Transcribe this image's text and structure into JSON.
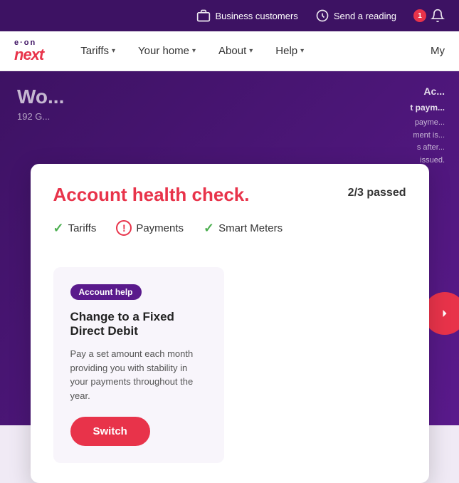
{
  "topbar": {
    "business_customers_label": "Business customers",
    "send_reading_label": "Send a reading",
    "notification_count": "1"
  },
  "navbar": {
    "logo_eon": "e·on",
    "logo_next": "next",
    "tariffs_label": "Tariffs",
    "your_home_label": "Your home",
    "about_label": "About",
    "help_label": "Help",
    "my_label": "My"
  },
  "bg": {
    "welcome_text": "Wo...",
    "address": "192 G..."
  },
  "modal": {
    "title": "Account health check.",
    "passed": "2/3 passed",
    "check_items": [
      {
        "label": "Tariffs",
        "status": "check"
      },
      {
        "label": "Payments",
        "status": "warning"
      },
      {
        "label": "Smart Meters",
        "status": "check"
      }
    ],
    "card": {
      "tag": "Account help",
      "title": "Change to a Fixed Direct Debit",
      "description": "Pay a set amount each month providing you with stability in your payments throughout the year.",
      "switch_label": "Switch"
    }
  },
  "right_content": {
    "payment_text": "t paym...",
    "payment_detail": "payme... ment is... s after... issued."
  }
}
